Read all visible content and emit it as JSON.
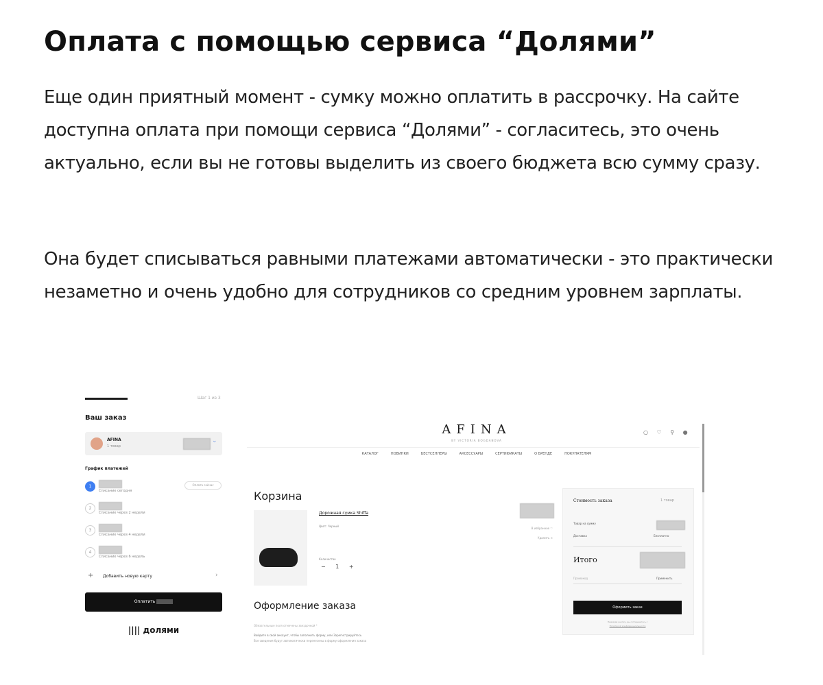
{
  "article": {
    "title": "Оплата с помощью сервиса “Долями”",
    "paragraph1": "Еще один приятный момент - сумку можно оплатить в рассрочку. На сайте доступна оплата при помощи сервиса “Долями” - согласитесь, это очень актуально, если вы не готовы выделить из своего бюджета всю сумму сразу.",
    "paragraph2": "Она будет списываться равными платежами автоматически - это практически незаметно и очень удобно для сотрудников со средним уровнем зарплаты."
  },
  "dolyami": {
    "top_right": "Шаг 1 из 3",
    "order_title": "Ваш заказ",
    "merchant_name": "AFINA",
    "merchant_sub": "1 товар",
    "schedule_title": "График платежей",
    "payments": [
      {
        "num": "1",
        "date": "Списание сегодня",
        "badge": "Оплата сейчас"
      },
      {
        "num": "2",
        "date": "Списание через 2 недели"
      },
      {
        "num": "3",
        "date": "Списание через 4 недели"
      },
      {
        "num": "4",
        "date": "Списание через 6 недель"
      }
    ],
    "add_card": "Добавить новую карту",
    "pay_button": "Оплатить",
    "brand": "|||| долями"
  },
  "shop": {
    "logo": "AFINA",
    "logo_sub": "BY VICTORIA BOGDANOVA",
    "icons": "○ ♡ ⚲ ●",
    "menu": [
      "КАТАЛОГ",
      "НОВИНКИ",
      "БЕСТСЕЛЛЕРЫ",
      "АКСЕССУАРЫ",
      "СЕРТИФИКАТЫ",
      "О БРЕНДЕ",
      "ПОКУПАТЕЛЯМ"
    ],
    "cart_title": "Корзина",
    "product_name": "Дорожная сумка Shiffa",
    "product_color": "Цвет: Черный",
    "qty_label": "Количество",
    "qty": "−  1  +",
    "favorite": "В избранное ♡",
    "delete": "Удалить ×",
    "checkout_title": "Оформление заказа",
    "required_note": "Обязательные поля отмечены звездочкой *",
    "note1": "Войдите в свой аккаунт, чтобы заполнить форму, или Зарегистрируйтесь",
    "note2": "Все сведения будут автоматически перенесены в форму оформления заказа",
    "summary": {
      "title": "Стоимость заказа",
      "count": "1 товар",
      "goods": "Товар на сумму",
      "delivery": "Доставка",
      "delivery_value": "Бесплатно",
      "total": "Итого",
      "promo": "Промокод",
      "apply": "Применить",
      "button": "Оформить заказ",
      "agree1": "Нажимая кнопку, вы соглашаетесь с",
      "agree2": "Политикой конфиденциальности"
    }
  }
}
